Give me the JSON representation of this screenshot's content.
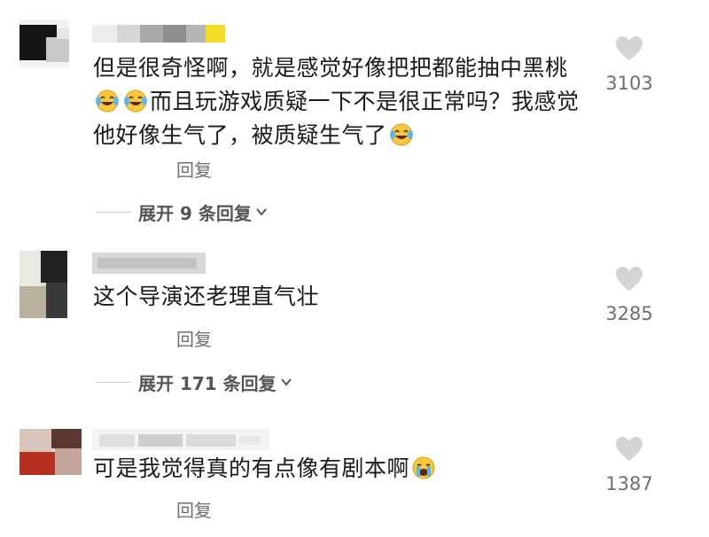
{
  "comments": [
    {
      "text_parts": [
        "但是很奇怪啊，就是感觉好像把把都能抽中黑桃",
        "",
        "",
        "而且玩游戏质疑一下不是很正常吗？我感觉他好像生气了，被质疑生气了",
        ""
      ],
      "emoji_after_parts": [
        "laugh-cry",
        "laugh-cry",
        "",
        "laugh-cry"
      ],
      "likes": "3103",
      "reply_label": "回复",
      "expand_label": "展开 9 条回复"
    },
    {
      "text": "这个导演还老理直气壮",
      "likes": "3285",
      "reply_label": "回复",
      "expand_label": "展开 171 条回复"
    },
    {
      "text": "可是我觉得真的有点像有剧本啊",
      "likes": "1387",
      "reply_label": "回复"
    }
  ],
  "colors": {
    "text": "#1a1a1a",
    "muted": "#6f6f6f",
    "heart": "#d4d4d4"
  }
}
